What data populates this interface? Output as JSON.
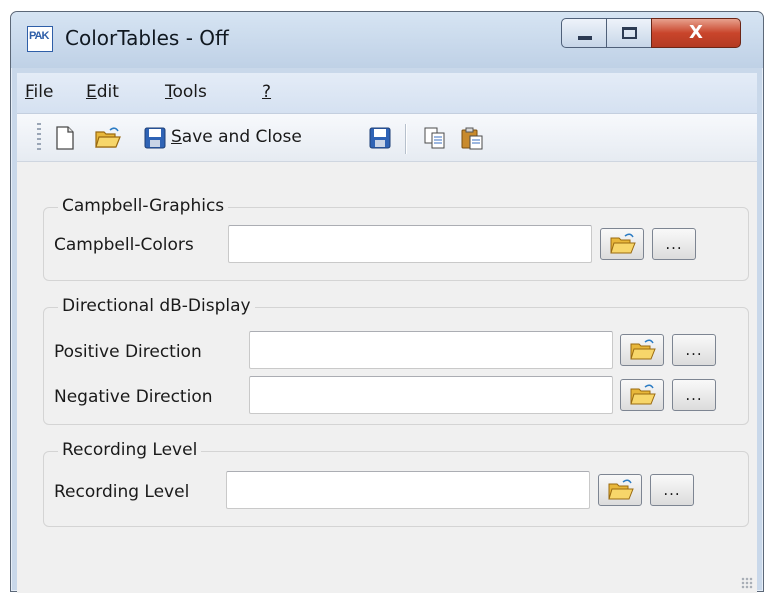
{
  "window": {
    "title": "ColorTables - Off",
    "app_logo_text": "PAK",
    "close_glyph": "X"
  },
  "menu": {
    "items": [
      {
        "mnemonic": "F",
        "rest": "ile"
      },
      {
        "mnemonic": "E",
        "rest": "dit"
      },
      {
        "mnemonic": "T",
        "rest": "ools"
      },
      {
        "mnemonic": "?",
        "rest": ""
      }
    ]
  },
  "toolbar": {
    "save_close_mnemonic": "S",
    "save_close_rest": "ave and Close",
    "icons": [
      "new-document-icon",
      "open-folder-icon",
      "save-icon",
      "save-icon",
      "copy-icon",
      "paste-icon"
    ]
  },
  "groups": {
    "campbell": {
      "legend": "Campbell-Graphics",
      "fields": [
        {
          "label": "Campbell-Colors",
          "value": ""
        }
      ]
    },
    "directional": {
      "legend": "Directional dB-Display",
      "fields": [
        {
          "label": "Positive Direction",
          "value": ""
        },
        {
          "label": "Negative Direction",
          "value": ""
        }
      ]
    },
    "recording": {
      "legend": "Recording Level",
      "fields": [
        {
          "label": "Recording Level",
          "value": ""
        }
      ]
    }
  },
  "browse_label": "...",
  "colors": {
    "title_bar": "#c9d8ea",
    "menu_bar": "#dbe5f3",
    "client_bg": "#f0f0f0",
    "close_button": "#c9452b"
  }
}
